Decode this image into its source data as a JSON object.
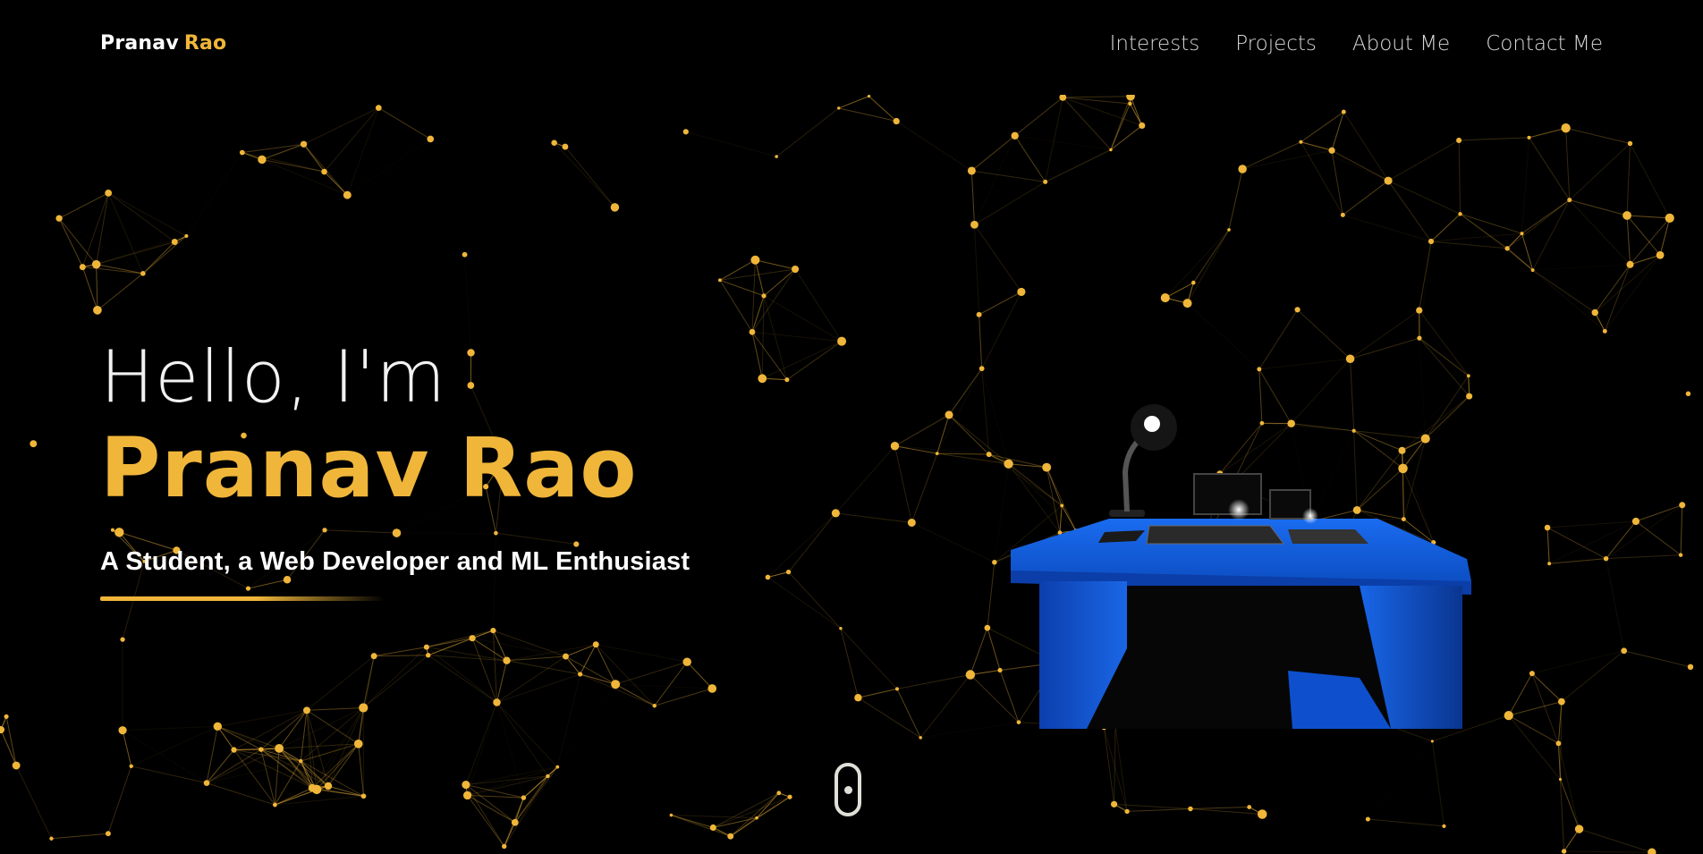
{
  "nav": {
    "brand_first": "Pranav",
    "brand_last": "Rao",
    "links": [
      "Interests",
      "Projects",
      "About Me",
      "Contact Me"
    ]
  },
  "hero": {
    "greeting": "Hello, I'm",
    "name": "Pranav Rao",
    "tagline": "A Student, a Web Developer and ML Enthusiast"
  },
  "colors": {
    "background": "#000000",
    "accent": "#f0b63a",
    "text": "#ffffff",
    "desk": "#1560d8"
  },
  "icons": {
    "scroll": "mouse-scroll-icon"
  }
}
